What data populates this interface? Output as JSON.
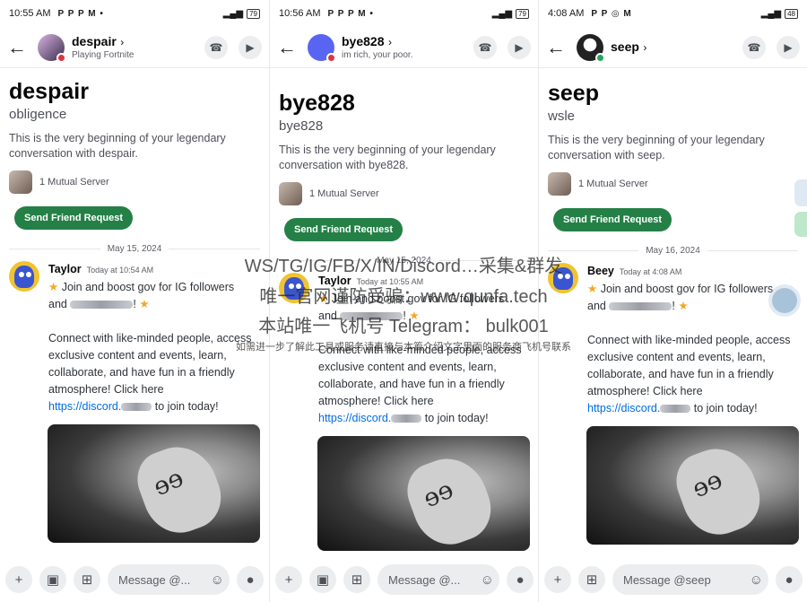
{
  "panels": [
    {
      "status": {
        "time": "10:55 AM",
        "icons": "P P P M •",
        "battery": "79"
      },
      "header": {
        "name": "despair",
        "chevron": "›",
        "subtitle": "Playing Fortnite"
      },
      "intro": {
        "display_name": "despair",
        "username": "obligence",
        "text": "This is the very beginning of your legendary conversation with despair.",
        "mutual": "1 Mutual Server",
        "friend_button": "Send Friend Request"
      },
      "date": "May 15, 2024",
      "message": {
        "author": "Taylor",
        "timestamp": "Today at 10:54 AM",
        "line1": "Join and boost gov for IG followers",
        "line2a": "and ",
        "line2b": "!",
        "line3": "Connect with like-minded people, access exclusive content and events, learn, collaborate, and have fun in a friendly atmosphere! Click here",
        "link": "https://discord.",
        "link_tail": " to join today!"
      },
      "composer": {
        "placeholder": "Message @..."
      }
    },
    {
      "status": {
        "time": "10:56 AM",
        "icons": "P P P M •",
        "battery": "79"
      },
      "header": {
        "name": "bye828",
        "chevron": "›",
        "subtitle": "im rich, your poor."
      },
      "intro": {
        "display_name": "bye828",
        "username": "bye828",
        "text": "This is the very beginning of your legendary conversation with bye828.",
        "mutual": "1 Mutual Server",
        "friend_button": "Send Friend Request"
      },
      "date": "May 15, 2024",
      "message": {
        "author": "Taylor",
        "timestamp": "Today at 10:55 AM",
        "line1": "Join and boost gov for IG followers",
        "line2a": "and ",
        "line2b": "!",
        "line3": "Connect with like-minded people, access exclusive content and events, learn, collaborate, and have fun in a friendly atmosphere! Click here",
        "link": "https://discord.",
        "link_tail": " to join today!"
      },
      "composer": {
        "placeholder": "Message @..."
      }
    },
    {
      "status": {
        "time": "4:08 AM",
        "icons": "P P ◎ M",
        "battery": "48"
      },
      "header": {
        "name": "seep",
        "chevron": "›",
        "subtitle": ""
      },
      "intro": {
        "display_name": "seep",
        "username": "wsle",
        "text": "This is the very beginning of your legendary conversation with seep.",
        "mutual": "1 Mutual Server",
        "friend_button": "Send Friend Request"
      },
      "date": "May 16, 2024",
      "message": {
        "author": "Beey",
        "timestamp": "Today at 4:08 AM",
        "line1": "Join and boost gov for IG followers",
        "line2a": "and ",
        "line2b": "!",
        "line3": "Connect with like-minded people, access exclusive content and events, learn, collaborate, and have fun in a friendly atmosphere! Click here",
        "link": "https://discord.",
        "link_tail": " to join today!"
      },
      "composer": {
        "placeholder": "Message @seep"
      }
    }
  ],
  "watermark": {
    "line1": "WS/TG/IG/FB/X/IN/Discord…采集&群发",
    "line2": "唯一官网谨防受骗：www.qunfa.tech",
    "line3": "本站唯一飞机号 Telegram：  bulk001",
    "line4": "如需进一步了解此工具或服务请直接与本篇介绍文字里面的服务商飞机号联系"
  },
  "colors": {
    "accent_green": "#248046",
    "link": "#006ce7",
    "status_red": "#da373c",
    "status_green": "#23a55a",
    "blurple": "#5865f2"
  }
}
